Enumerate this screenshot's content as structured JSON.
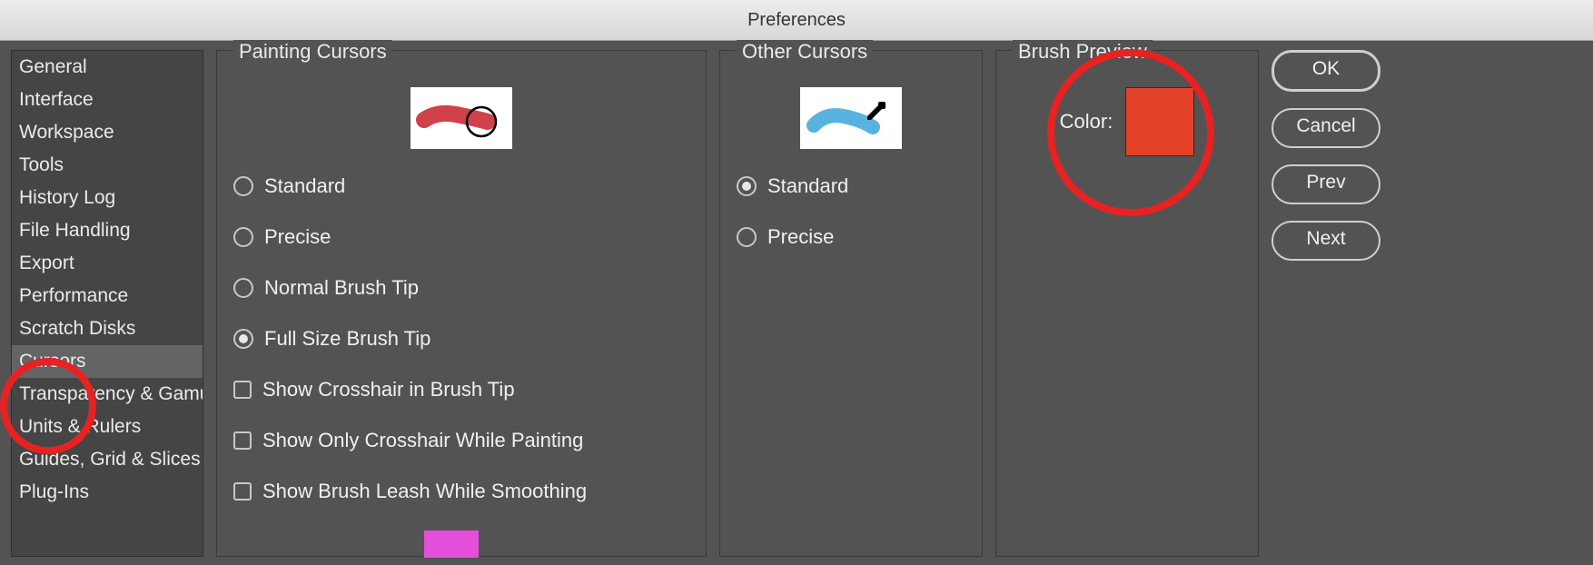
{
  "window": {
    "title": "Preferences"
  },
  "sidebar": {
    "items": [
      {
        "label": "General"
      },
      {
        "label": "Interface"
      },
      {
        "label": "Workspace"
      },
      {
        "label": "Tools"
      },
      {
        "label": "History Log"
      },
      {
        "label": "File Handling"
      },
      {
        "label": "Export"
      },
      {
        "label": "Performance"
      },
      {
        "label": "Scratch Disks"
      },
      {
        "label": "Cursors"
      },
      {
        "label": "Transparency & Gamut"
      },
      {
        "label": "Units & Rulers"
      },
      {
        "label": "Guides, Grid & Slices"
      },
      {
        "label": "Plug-Ins"
      }
    ],
    "selected_index": 9
  },
  "painting_cursors": {
    "title": "Painting Cursors",
    "options": [
      {
        "label": "Standard",
        "type": "radio",
        "selected": false
      },
      {
        "label": "Precise",
        "type": "radio",
        "selected": false
      },
      {
        "label": "Normal Brush Tip",
        "type": "radio",
        "selected": false
      },
      {
        "label": "Full Size Brush Tip",
        "type": "radio",
        "selected": true
      },
      {
        "label": "Show Crosshair in Brush Tip",
        "type": "check",
        "selected": false
      },
      {
        "label": "Show Only Crosshair While Painting",
        "type": "check",
        "selected": false
      },
      {
        "label": "Show Brush Leash While Smoothing",
        "type": "check",
        "selected": false
      }
    ]
  },
  "other_cursors": {
    "title": "Other Cursors",
    "options": [
      {
        "label": "Standard",
        "type": "radio",
        "selected": true
      },
      {
        "label": "Precise",
        "type": "radio",
        "selected": false
      }
    ]
  },
  "brush_preview": {
    "title": "Brush Preview",
    "color_label": "Color:",
    "color": "#e34128"
  },
  "buttons": {
    "ok": "OK",
    "cancel": "Cancel",
    "prev": "Prev",
    "next": "Next"
  }
}
